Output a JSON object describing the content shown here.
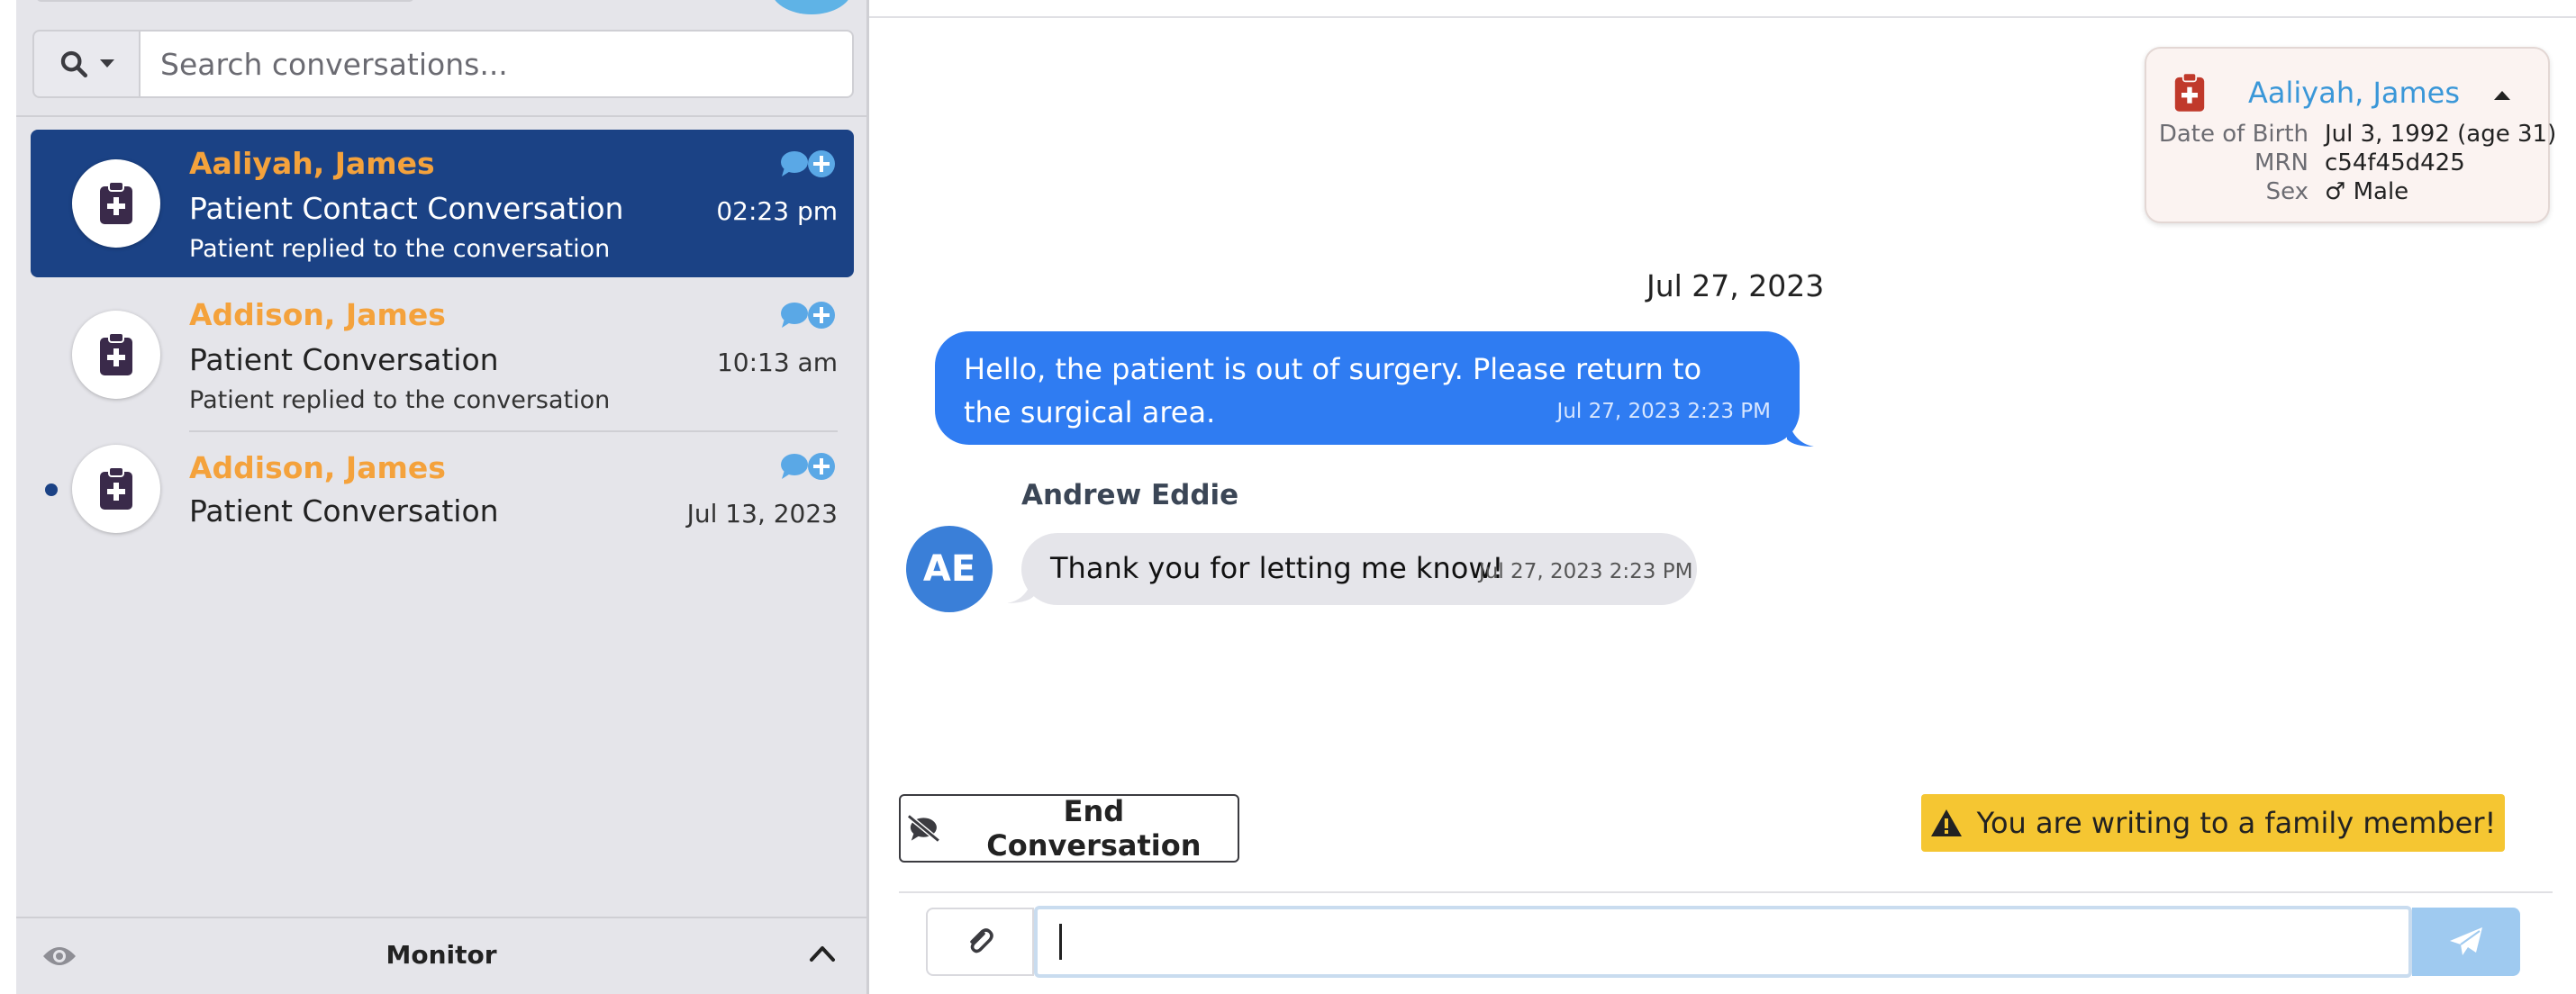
{
  "search": {
    "placeholder": "Search conversations..."
  },
  "conversations": [
    {
      "name": "Aaliyah, James",
      "title": "Patient Contact Conversation",
      "time": "02:23 pm",
      "subtitle": "Patient replied to the conversation",
      "active": true,
      "unread": false
    },
    {
      "name": "Addison, James",
      "title": "Patient Conversation",
      "time": "10:13 am",
      "subtitle": "Patient replied to the conversation",
      "active": false,
      "unread": false
    },
    {
      "name": "Addison, James",
      "title": "Patient Conversation",
      "time": "Jul 13, 2023",
      "subtitle": "",
      "active": false,
      "unread": true
    }
  ],
  "monitor": {
    "label": "Monitor"
  },
  "patient": {
    "name": "Aaliyah, James",
    "dob_label": "Date of Birth",
    "dob": "Jul 3, 1992 (age 31)",
    "mrn_label": "MRN",
    "mrn": "c54f45d425",
    "sex_label": "Sex",
    "sex": "♂ Male"
  },
  "thread": {
    "date": "Jul 27, 2023",
    "outgoing": {
      "text": "Hello, the patient is out of surgery. Please return to the surgical area.",
      "timestamp": "Jul 27, 2023 2:23 PM"
    },
    "incoming": {
      "sender": "Andrew Eddie",
      "initials": "AE",
      "text": "Thank you for letting me know!",
      "timestamp": "Jul 27, 2023 2:23 PM"
    }
  },
  "actions": {
    "end_label": "End Conversation"
  },
  "warning": {
    "text": "You are writing to a family member!"
  },
  "composer": {
    "value": ""
  },
  "colors": {
    "active_conversation": "#1b4285",
    "contact_name": "#f4a23c",
    "outgoing_bubble": "#2f7cf2",
    "incoming_bubble": "#e5e5ea",
    "warning": "#f5c632",
    "patient_icon": "#c0392b"
  },
  "icons": [
    "search-icon",
    "clipboard-medical-icon",
    "chat-plus-icon",
    "eye-icon",
    "chevron-up-icon",
    "caret-up-icon",
    "comment-slash-icon",
    "warning-triangle-icon",
    "paperclip-icon",
    "send-icon"
  ]
}
